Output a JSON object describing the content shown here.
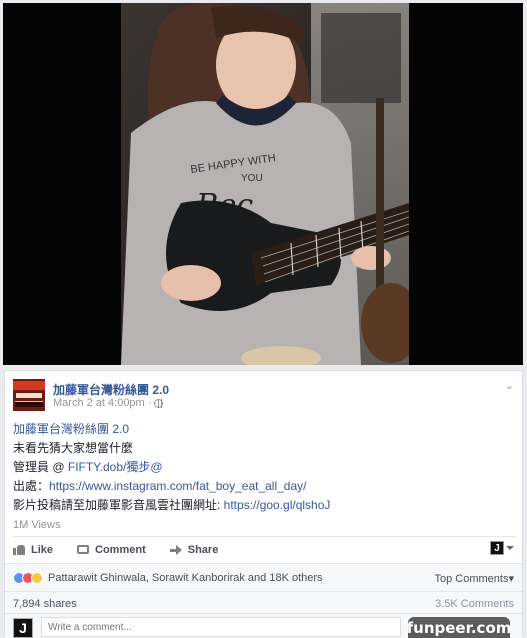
{
  "video": {
    "shirt_text_line1": "BE HAPPY WITH",
    "shirt_text_line2": "YOU",
    "shirt_script": "Rec"
  },
  "post": {
    "page_name": "加藤軍台灣粉絲團 2.0",
    "timestamp": "March 2 at 4:00pm",
    "dot": "·",
    "body": {
      "line1": "加藤軍台灣粉絲團 2.0",
      "line2_prefix": "未看先猜大家想當什麼",
      "line3_prefix": "管理員 @ ",
      "line3_link": "FIFTY.dob/獨步@",
      "line4_prefix": "出處：",
      "line4_link": "https://www.instagram.com/fat_boy_eat_all_day/",
      "line5_prefix": "影片投稿請至加藤軍影音風雲社團網址: ",
      "line5_link": "https://goo.gl/qlshoJ"
    },
    "views": "1M Views",
    "actions": {
      "like": "Like",
      "comment": "Comment",
      "share": "Share"
    },
    "page_avatar_glyph": "J",
    "reactions_text": "Pattarawit Ghinwala, Sorawit Kanborirak and 18K others",
    "top_comments": "Top Comments",
    "top_comments_caret": "▾",
    "shares": "7,894 shares",
    "comments_count": "3.5K Comments",
    "comment_placeholder": "Write a comment...",
    "chevron": "⌄"
  },
  "watermark": "funpeer.com",
  "colors": {
    "link": "#365899",
    "like": "#5890ff",
    "love": "#f25268",
    "wow": "#f7c742"
  }
}
